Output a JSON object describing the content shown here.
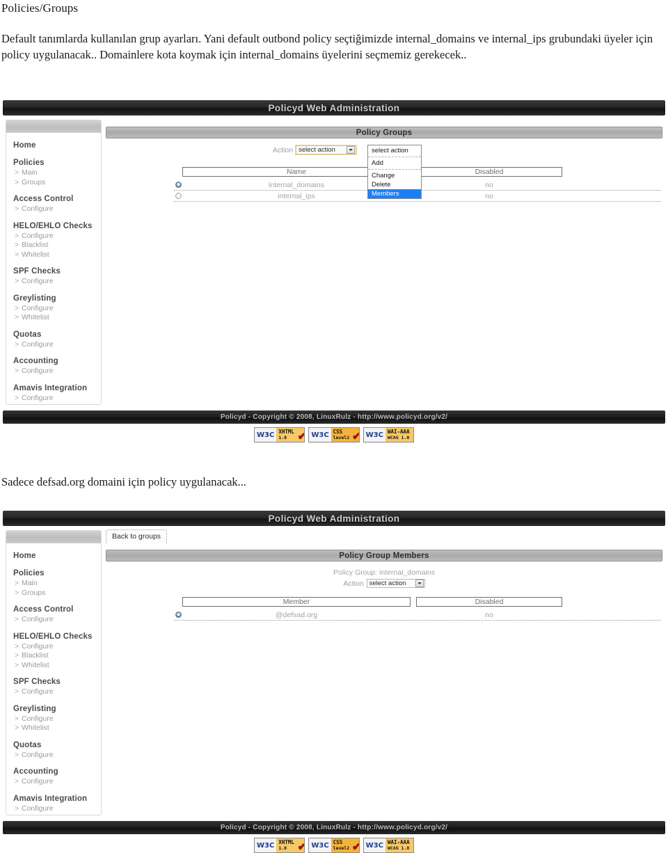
{
  "document": {
    "title": "Policies/Groups",
    "paragraph": "Default tanımlarda kullanılan grup ayarları. Yani default outbond policy seçtiğimizde internal_domains ve internal_ips grubundaki üyeler için policy uygulanacak.. Domainlere kota koymak için internal_domains üyelerini seçmemiz gerekecek..",
    "caption": "Sadece defsad.org domaini için policy uygulanacak..."
  },
  "app": {
    "title": "Policyd Web Administration",
    "footer_text": "Policyd - Copyright © 2008, LinuxRulz - http://www.policyd.org/v2/",
    "badges": [
      {
        "name": "xhtml-badge",
        "logo": "W3C",
        "line1": "XHTML",
        "line2": "1.0",
        "check": true,
        "style": "cream"
      },
      {
        "name": "css-badge",
        "logo": "W3C",
        "line1": "CSS",
        "line2": "level2",
        "check": true,
        "style": "orange"
      },
      {
        "name": "wai-badge",
        "logo": "W3C",
        "line1": "WAI-AAA",
        "line2": "WCAG 1.0",
        "check": false,
        "style": "cream"
      }
    ]
  },
  "sidebar": {
    "groups": [
      {
        "head": "Home",
        "items": []
      },
      {
        "head": "Policies",
        "items": [
          "Main",
          "Groups"
        ]
      },
      {
        "head": "Access Control",
        "items": [
          "Configure"
        ]
      },
      {
        "head": "HELO/EHLO Checks",
        "items": [
          "Configure",
          "Blacklist",
          "Whitelist"
        ]
      },
      {
        "head": "SPF Checks",
        "items": [
          "Configure"
        ]
      },
      {
        "head": "Greylisting",
        "items": [
          "Configure",
          "Whitelist"
        ]
      },
      {
        "head": "Quotas",
        "items": [
          "Configure"
        ]
      },
      {
        "head": "Accounting",
        "items": [
          "Configure"
        ]
      },
      {
        "head": "Amavis Integration",
        "items": [
          "Configure"
        ]
      }
    ]
  },
  "screen1": {
    "panel_title": "Policy Groups",
    "action_label": "Action",
    "action_value": "select action",
    "dropdown_open": true,
    "dropdown_options": [
      {
        "label": "select action",
        "selected": false,
        "sep": true
      },
      {
        "label": "Add",
        "selected": false,
        "sep": true
      },
      {
        "label": "Change",
        "selected": false,
        "sep": false
      },
      {
        "label": "Delete",
        "selected": false,
        "sep": false
      },
      {
        "label": "Members",
        "selected": true,
        "sep": false
      }
    ],
    "columns": [
      "Name",
      "Disabled"
    ],
    "rows": [
      {
        "selected": true,
        "name": "internal_domains",
        "disabled": "no"
      },
      {
        "selected": false,
        "name": "internal_ips",
        "disabled": "no"
      }
    ]
  },
  "screen2": {
    "back_button": "Back to groups",
    "panel_title": "Policy Group Members",
    "group_label": "Policy Group: internal_domains",
    "action_label": "Action",
    "action_value": "select action",
    "columns": [
      "Member",
      "Disabled"
    ],
    "rows": [
      {
        "selected": true,
        "member": "@defsad.org",
        "disabled": "no"
      }
    ]
  },
  "colors": {
    "accent_selected": "#1e7ff5",
    "badge_orange": "#f2b33c",
    "titlebar": "#1e1e1e"
  }
}
